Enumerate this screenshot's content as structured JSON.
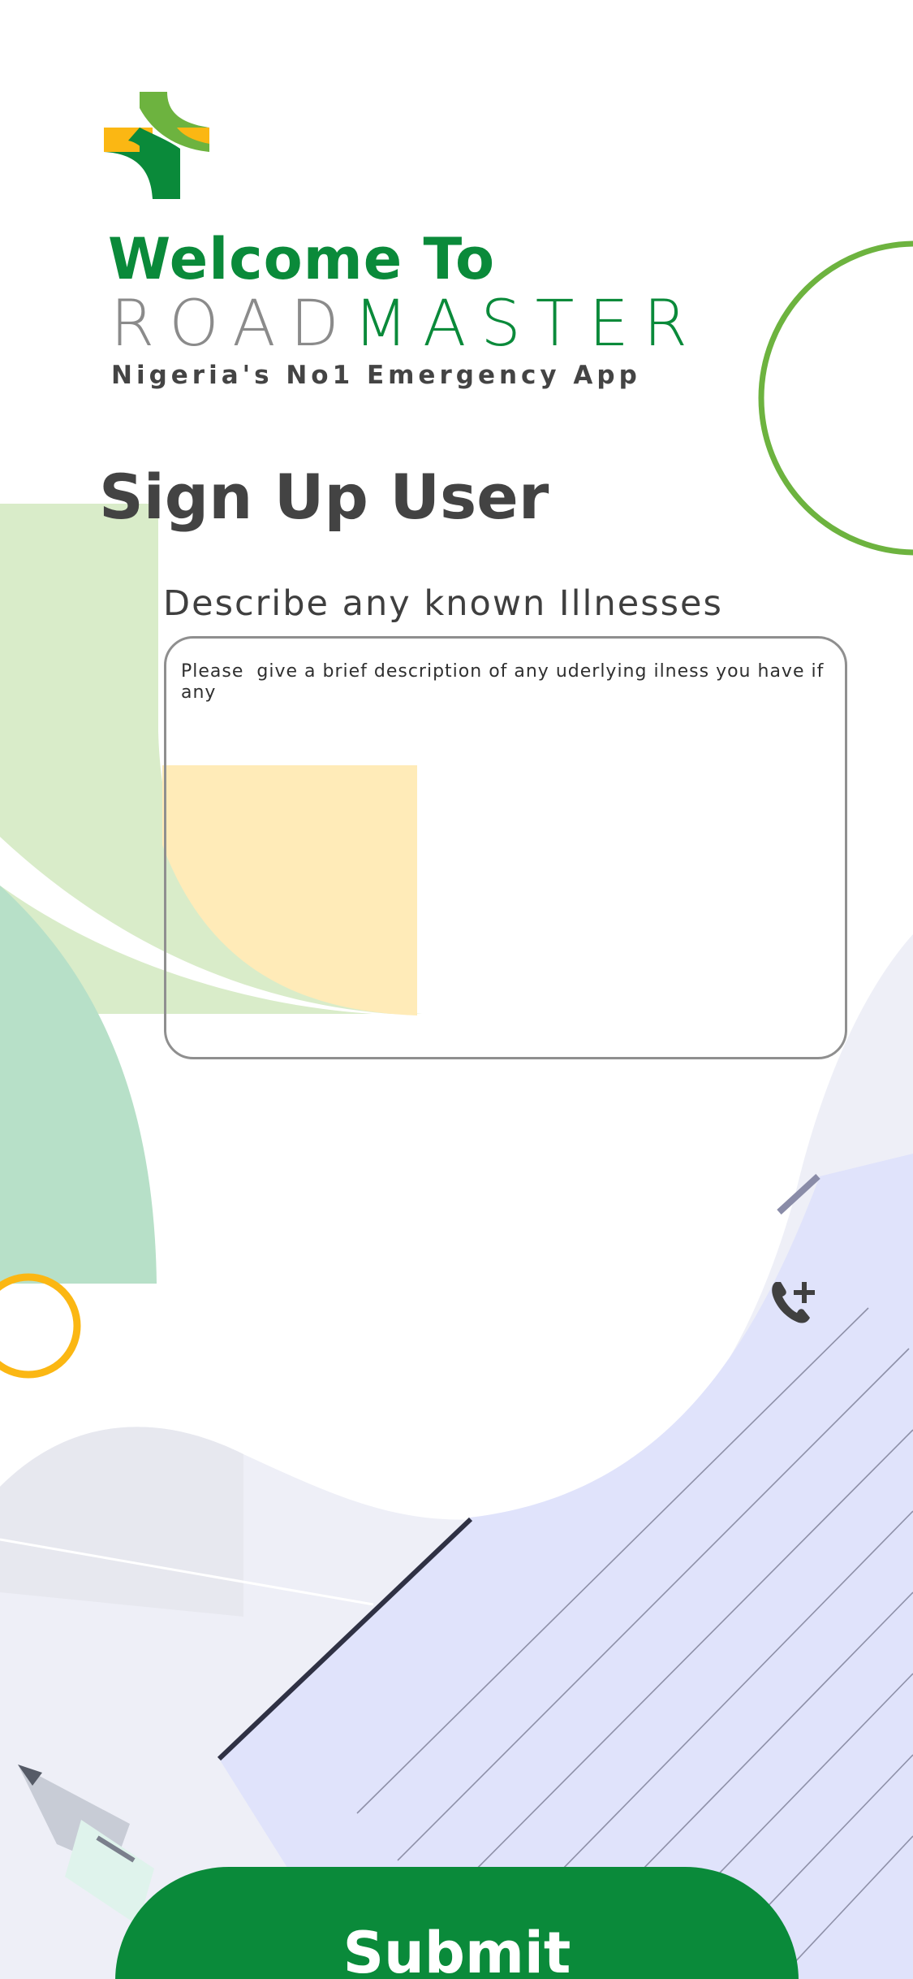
{
  "header": {
    "welcome": "Welcome To",
    "brand_part1": "ROAD",
    "brand_part2": "MASTER",
    "tagline": "Nigeria's No1 Emergency App"
  },
  "page": {
    "title": "Sign Up User"
  },
  "form": {
    "illness_label": "Describe any known Illnesses",
    "illness_placeholder": "Please  give a brief description of any uderlying ilness you have if any",
    "illness_value": ""
  },
  "actions": {
    "submit_label": "Submit"
  },
  "icons": {
    "logo": "medical-cross-logo",
    "phone": "phone-add-icon"
  },
  "colors": {
    "brand_green": "#0a8a3a",
    "light_green": "#6db33f",
    "yellow": "#fbb713",
    "pale_green": "#d9ecc9",
    "mint": "#b7e0c8",
    "pale_yellow": "#ffebb8",
    "gray_text": "#434343"
  }
}
